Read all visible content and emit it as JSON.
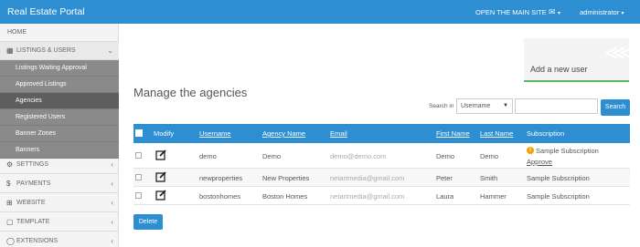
{
  "topbar": {
    "title": "Real Estate Portal",
    "open_site": "OPEN THE MAIN SITE",
    "mail_icon": "envelope-icon",
    "admin_label": "administrator"
  },
  "sidebar": {
    "home": "HOME",
    "listings_users": "LISTINGS & USERS",
    "sub_items": [
      "Listings Waiting Approval",
      "Approved Listings",
      "Agencies",
      "Registered Users",
      "Banner Zones",
      "Banners"
    ],
    "active_sub": "Agencies",
    "settings": "SETTINGS",
    "payments": "PAYMENTS",
    "website": "WEBSITE",
    "template": "TEMPLATE",
    "extensions": "EXTENSIONS"
  },
  "add_card": {
    "label": "Add a new user",
    "icon": "share-icon"
  },
  "main": {
    "title": "Manage the agencies",
    "search_in_label": "Search in",
    "search_field": "Username",
    "search_value": "",
    "search_button": "Search",
    "delete_button": "Delete"
  },
  "table": {
    "headers": {
      "modify": "Modify",
      "username": "Username",
      "agency": "Agency Name",
      "email": "Email",
      "first": "First Name",
      "last": "Last Name",
      "subscription": "Subscription"
    },
    "rows": [
      {
        "username": "demo",
        "agency": "Demo",
        "email": "demo@demo.com",
        "first": "Demo",
        "last": "Demo",
        "subscription": "Sample Subscription",
        "warning": true,
        "approve": "Approve"
      },
      {
        "username": "newproperties",
        "agency": "New Properties",
        "email": "netartmedia@gmail.com",
        "first": "Peter",
        "last": "Smith",
        "subscription": "Sample Subscription"
      },
      {
        "username": "bostonhomes",
        "agency": "Boston Homes",
        "email": "netartmedia@gmail.com",
        "first": "Laura",
        "last": "Hammer",
        "subscription": "Sample Subscription"
      }
    ]
  },
  "colors": {
    "primary": "#2d8ed1",
    "sidebar_sub": "#8a8a8a",
    "sidebar_active": "#5e5e5e",
    "accent_green": "#5cb85c",
    "warning": "#f0a400"
  }
}
